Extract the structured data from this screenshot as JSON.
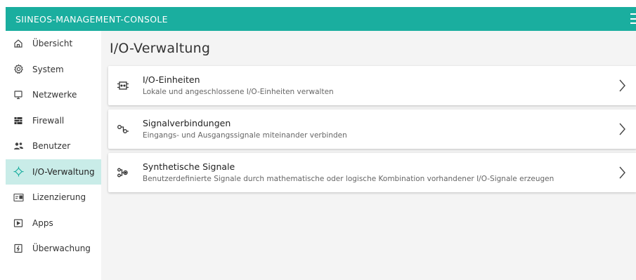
{
  "header": {
    "app_title": "SIINEOS-MANAGEMENT-CONSOLE",
    "accent_color": "#1aae9f",
    "menu_icon": "hamburger-icon"
  },
  "sidebar": {
    "items": [
      {
        "label": "Übersicht",
        "icon": "home-icon",
        "active": false
      },
      {
        "label": "System",
        "icon": "gear-icon",
        "active": false
      },
      {
        "label": "Netzwerke",
        "icon": "monitor-icon",
        "active": false
      },
      {
        "label": "Firewall",
        "icon": "firewall-icon",
        "active": false
      },
      {
        "label": "Benutzer",
        "icon": "users-icon",
        "active": false
      },
      {
        "label": "I/O-Verwaltung",
        "icon": "io-icon",
        "active": true
      },
      {
        "label": "Lizenzierung",
        "icon": "license-icon",
        "active": false
      },
      {
        "label": "Apps",
        "icon": "apps-icon",
        "active": false
      },
      {
        "label": "Überwachung",
        "icon": "monitoring-icon",
        "active": false
      }
    ]
  },
  "main": {
    "page_title": "I/O-Verwaltung",
    "cards": [
      {
        "title": "I/O-Einheiten",
        "subtitle": "Lokale und angeschlossene I/O-Einheiten verwalten",
        "icon": "io-unit-icon"
      },
      {
        "title": "Signalverbindungen",
        "subtitle": "Eingangs- und Ausgangssignale miteinander verbinden",
        "icon": "signal-connection-icon"
      },
      {
        "title": "Synthetische Signale",
        "subtitle": "Benutzerdefinierte Signale durch mathematische oder logische Kombination vorhandener I/O-Signale erzeugen",
        "icon": "synthetic-signal-icon"
      }
    ]
  }
}
